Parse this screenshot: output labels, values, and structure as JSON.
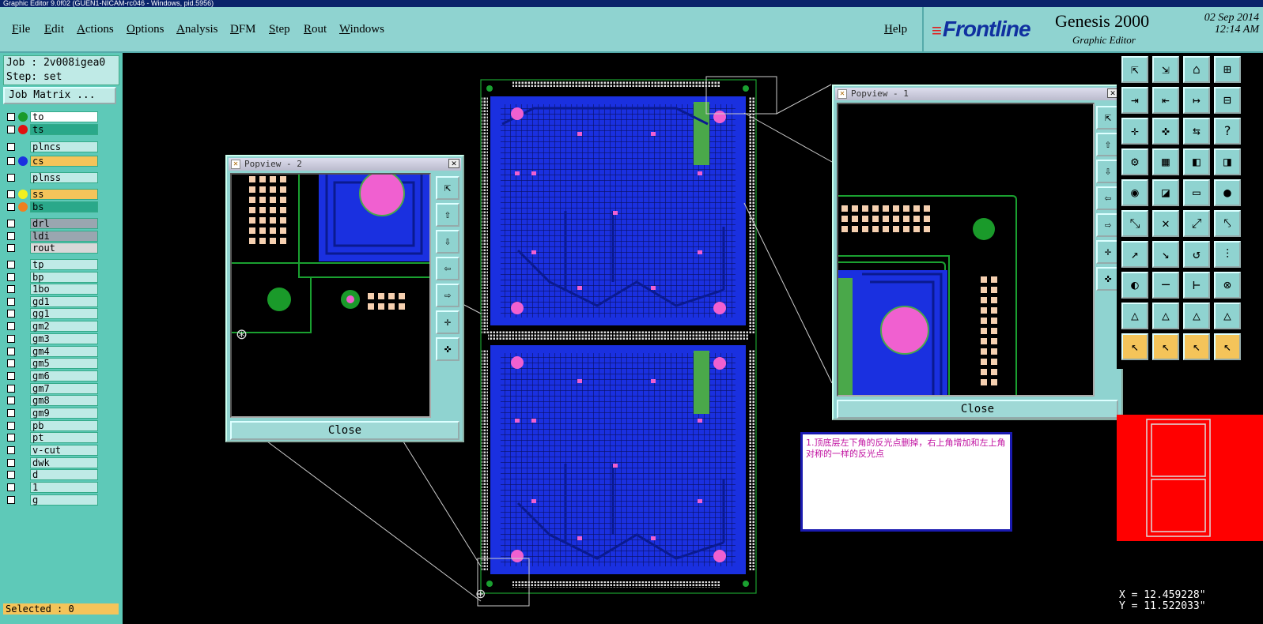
{
  "window": {
    "title": "Graphic Editor 9.0f02 (GUEN1-NICAM-rc046 - Windows, pid.5956)"
  },
  "menu": {
    "items": [
      "File",
      "Edit",
      "Actions",
      "Options",
      "Analysis",
      "DFM",
      "Step",
      "Rout",
      "Windows"
    ],
    "help": "Help"
  },
  "brand": {
    "logo": "Frontline",
    "product": "Genesis 2000",
    "subtitle": "Graphic Editor",
    "date": "02 Sep 2014",
    "time": "12:14 AM"
  },
  "job": {
    "job_line": "Job : 2v008igea0",
    "step_line": "Step: set",
    "matrix_button": "Job Matrix ..."
  },
  "layers": [
    {
      "name": "to",
      "dot": "#1a9a2a",
      "bg": "#ffffff"
    },
    {
      "name": "ts",
      "dot": "#e01010",
      "bg": "#2aa88a"
    },
    {
      "name": "plncs",
      "dot": "",
      "bg": "#bfeae6"
    },
    {
      "name": "cs",
      "dot": "#1a30e0",
      "bg": "#f4c45a"
    },
    {
      "name": "plnss",
      "dot": "",
      "bg": "#bfeae6"
    },
    {
      "name": "ss",
      "dot": "#f4f020",
      "bg": "#f4c45a"
    },
    {
      "name": "bs",
      "dot": "#f08020",
      "bg": "#2aa88a"
    },
    {
      "name": "drl",
      "dot": "",
      "bg": "#9aa6b0"
    },
    {
      "name": "ldi",
      "dot": "",
      "bg": "#9aa6b0"
    },
    {
      "name": "rout",
      "dot": "",
      "bg": "#d8d8d8"
    },
    {
      "name": "tp",
      "dot": "",
      "bg": "#bfeae6"
    },
    {
      "name": "bp",
      "dot": "",
      "bg": "#bfeae6"
    },
    {
      "name": "1bo",
      "dot": "",
      "bg": "#bfeae6"
    },
    {
      "name": "gd1",
      "dot": "",
      "bg": "#bfeae6"
    },
    {
      "name": "gg1",
      "dot": "",
      "bg": "#bfeae6"
    },
    {
      "name": "gm2",
      "dot": "",
      "bg": "#bfeae6"
    },
    {
      "name": "gm3",
      "dot": "",
      "bg": "#bfeae6"
    },
    {
      "name": "gm4",
      "dot": "",
      "bg": "#bfeae6"
    },
    {
      "name": "gm5",
      "dot": "",
      "bg": "#bfeae6"
    },
    {
      "name": "gm6",
      "dot": "",
      "bg": "#bfeae6"
    },
    {
      "name": "gm7",
      "dot": "",
      "bg": "#bfeae6"
    },
    {
      "name": "gm8",
      "dot": "",
      "bg": "#bfeae6"
    },
    {
      "name": "gm9",
      "dot": "",
      "bg": "#bfeae6"
    },
    {
      "name": "pb",
      "dot": "",
      "bg": "#bfeae6"
    },
    {
      "name": "pt",
      "dot": "",
      "bg": "#bfeae6"
    },
    {
      "name": "v-cut",
      "dot": "",
      "bg": "#bfeae6"
    },
    {
      "name": "dwk",
      "dot": "",
      "bg": "#bfeae6"
    },
    {
      "name": "d",
      "dot": "",
      "bg": "#bfeae6"
    },
    {
      "name": "1",
      "dot": "",
      "bg": "#bfeae6"
    },
    {
      "name": "g",
      "dot": "",
      "bg": "#bfeae6"
    }
  ],
  "status": {
    "selected": "Selected : 0"
  },
  "popview1": {
    "title": "Popview - 1",
    "close": "Close"
  },
  "popview2": {
    "title": "Popview - 2",
    "close": "Close"
  },
  "note": "1.顶底层左下角的反光点删掉，右上角增加和左上角对称的一样的反光点",
  "coords": {
    "x": "X = 12.459228\"",
    "y": "Y = 11.522033\""
  },
  "colors": {
    "panel": "#8fd3d0",
    "copper": "#1a30e0",
    "pad": "#f060d0",
    "trace": "#1aa030",
    "highlight": "#ff0000"
  }
}
